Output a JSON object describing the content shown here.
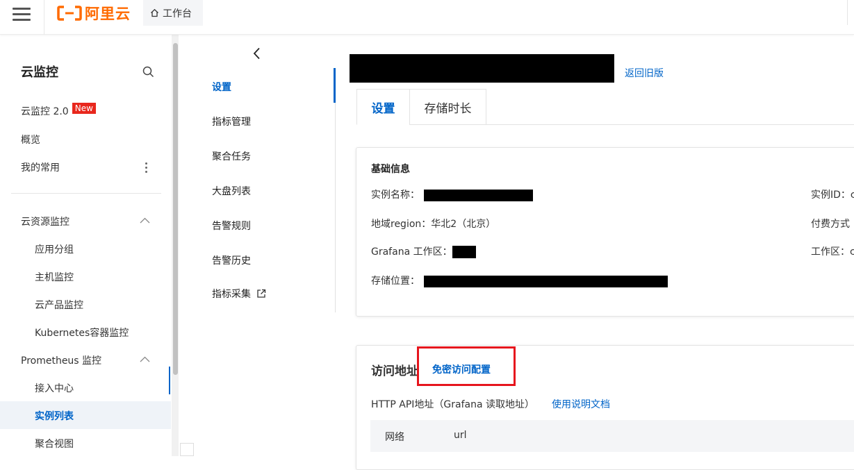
{
  "topbar": {
    "logo_text": "阿里云",
    "brand_color": "#ff6a00",
    "workbench_label": "工作台",
    "icons": [
      "menu-icon",
      "home-icon"
    ]
  },
  "sidebar": {
    "title": "云监控",
    "items": [
      {
        "label": "云监控 2.0",
        "badge": "New"
      },
      {
        "label": "概览"
      },
      {
        "label": "我的常用"
      }
    ],
    "groups": [
      {
        "label": "云资源监控",
        "expanded": true,
        "children": [
          "应用分组",
          "主机监控",
          "云产品监控",
          "Kubernetes容器监控"
        ]
      },
      {
        "label": "Prometheus 监控",
        "expanded": true,
        "children": [
          "接入中心",
          "实例列表",
          "聚合视图"
        ]
      }
    ],
    "active_item": "实例列表",
    "accent_color": "#0064c8"
  },
  "subnav": {
    "items": [
      "设置",
      "指标管理",
      "聚合任务",
      "大盘列表",
      "告警规则",
      "告警历史",
      "指标采集"
    ],
    "active": "设置"
  },
  "header": {
    "back_link": "返回旧版"
  },
  "tabs": [
    "设置",
    "存储时长"
  ],
  "basic_info": {
    "title": "基础信息",
    "instance_name_label": "实例名称：",
    "region_label": "地域region：",
    "region_value": "华北2（北京）",
    "grafana_label": "Grafana 工作区：",
    "storage_label": "存储位置：",
    "instance_id_label": "实例ID：",
    "instance_id_value_partial": "c",
    "billing_label": "付费方式",
    "workspace_label": "工作区：",
    "workspace_value_partial": "c"
  },
  "access": {
    "title": "访问地址",
    "passwordless_link": "免密访问配置",
    "http_api_label": "HTTP API地址（Grafana 读取地址）",
    "doc_link": "使用说明文档",
    "table_headers": [
      "网络",
      "url"
    ]
  }
}
